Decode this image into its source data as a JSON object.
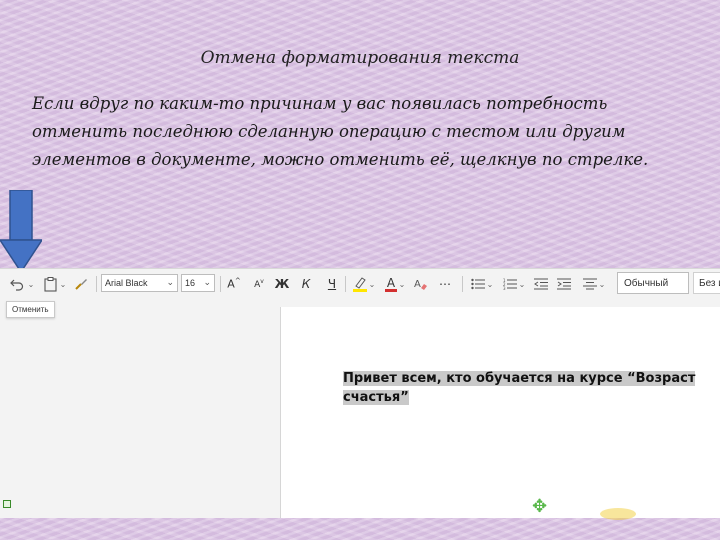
{
  "slide": {
    "title": "Отмена форматирования текста",
    "body": "Если вдруг по каким-то причинам у вас появилась потребность отменить последнюю сделанную операцию с тестом или другим элементов в документе, можно отменить её,  щелкнув по стрелке."
  },
  "ribbon": {
    "font_name": "Arial Black",
    "font_size": "16",
    "bold_label": "Ж",
    "italic_label": "К",
    "underline_label": "Ч",
    "style_name": "Обычный",
    "style_next": "Без и"
  },
  "tooltip": {
    "undo_label": "Отменить"
  },
  "document": {
    "text": "Привет всем, кто обучается на курсе  “Возраст счастья”"
  },
  "colors": {
    "arrow": "#4472c4",
    "highlight": "#ffe600",
    "font_color": "#d32f2f"
  }
}
